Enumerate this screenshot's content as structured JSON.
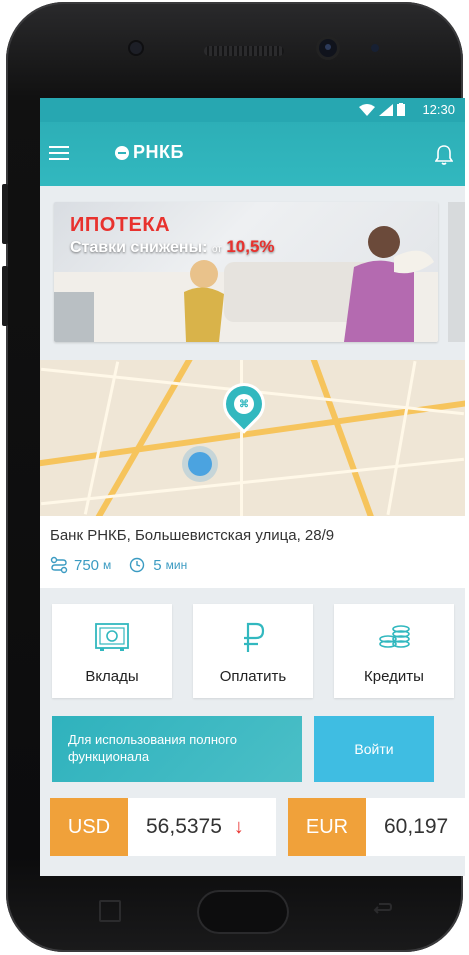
{
  "status_bar": {
    "time": "12:30"
  },
  "app_bar": {
    "logo_text": "РНКБ",
    "menu_icon": "menu-icon",
    "bell_icon": "bell-icon"
  },
  "banner": {
    "title": "ИПОТЕКА",
    "subtitle": "Ставки снижены:",
    "from": "от",
    "rate": "10,5%"
  },
  "branch": {
    "name": "Банк РНКБ,  Большевистская улица, 28/9",
    "distance": "750",
    "distance_unit": "м",
    "time": "5",
    "time_unit": "мин"
  },
  "tiles": [
    {
      "label": "Вклады",
      "icon": "safe-icon"
    },
    {
      "label": "Оплатить",
      "icon": "ruble-icon"
    },
    {
      "label": "Кредиты",
      "icon": "coins-icon"
    }
  ],
  "promo": {
    "text": "Для использования полного функционала",
    "login_label": "Войти"
  },
  "rates": [
    {
      "code": "USD",
      "value": "56,5375",
      "trend": "↓"
    },
    {
      "code": "EUR",
      "value": "60,197"
    }
  ],
  "colors": {
    "accent": "#32b8bf",
    "currency": "#f0a13a",
    "down": "#e8322e",
    "login": "#3fbde2"
  }
}
